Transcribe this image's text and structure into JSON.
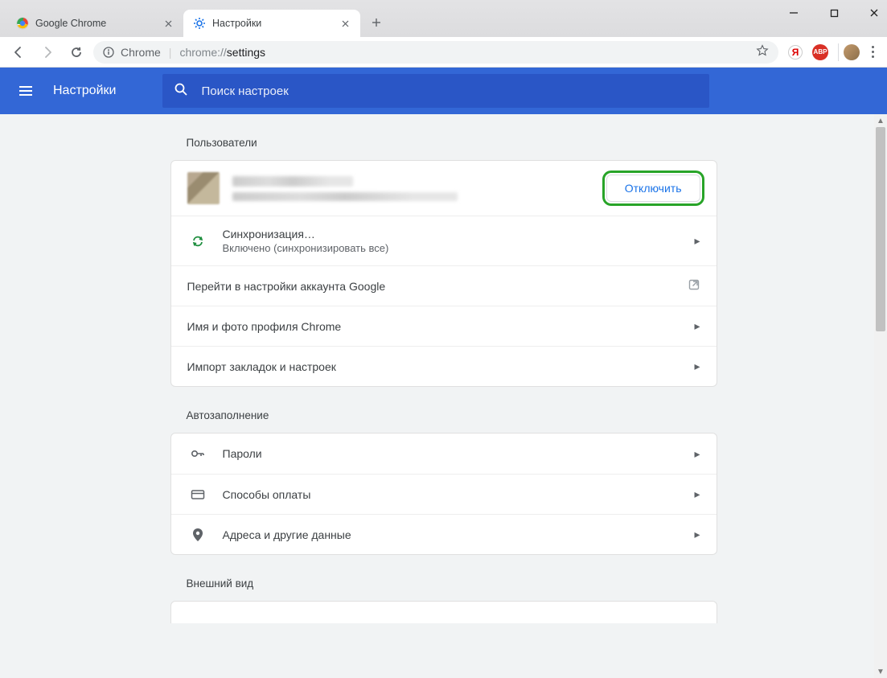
{
  "window": {
    "tabs": [
      {
        "title": "Google Chrome",
        "active": false
      },
      {
        "title": "Настройки",
        "active": true
      }
    ]
  },
  "toolbar": {
    "secure_label": "Chrome",
    "address_prefix": "chrome://",
    "address_path": "settings"
  },
  "header": {
    "title": "Настройки",
    "search_placeholder": "Поиск настроек"
  },
  "sections": {
    "users": {
      "title": "Пользователи",
      "disconnect_label": "Отключить",
      "rows": {
        "sync": {
          "title": "Синхронизация…",
          "subtitle": "Включено (синхронизировать все)"
        },
        "account": {
          "title": "Перейти в настройки аккаунта Google"
        },
        "profile": {
          "title": "Имя и фото профиля Chrome"
        },
        "import": {
          "title": "Импорт закладок и настроек"
        }
      }
    },
    "autofill": {
      "title": "Автозаполнение",
      "rows": {
        "passwords": {
          "title": "Пароли"
        },
        "payments": {
          "title": "Способы оплаты"
        },
        "addresses": {
          "title": "Адреса и другие данные"
        }
      }
    },
    "appearance": {
      "title": "Внешний вид"
    }
  }
}
